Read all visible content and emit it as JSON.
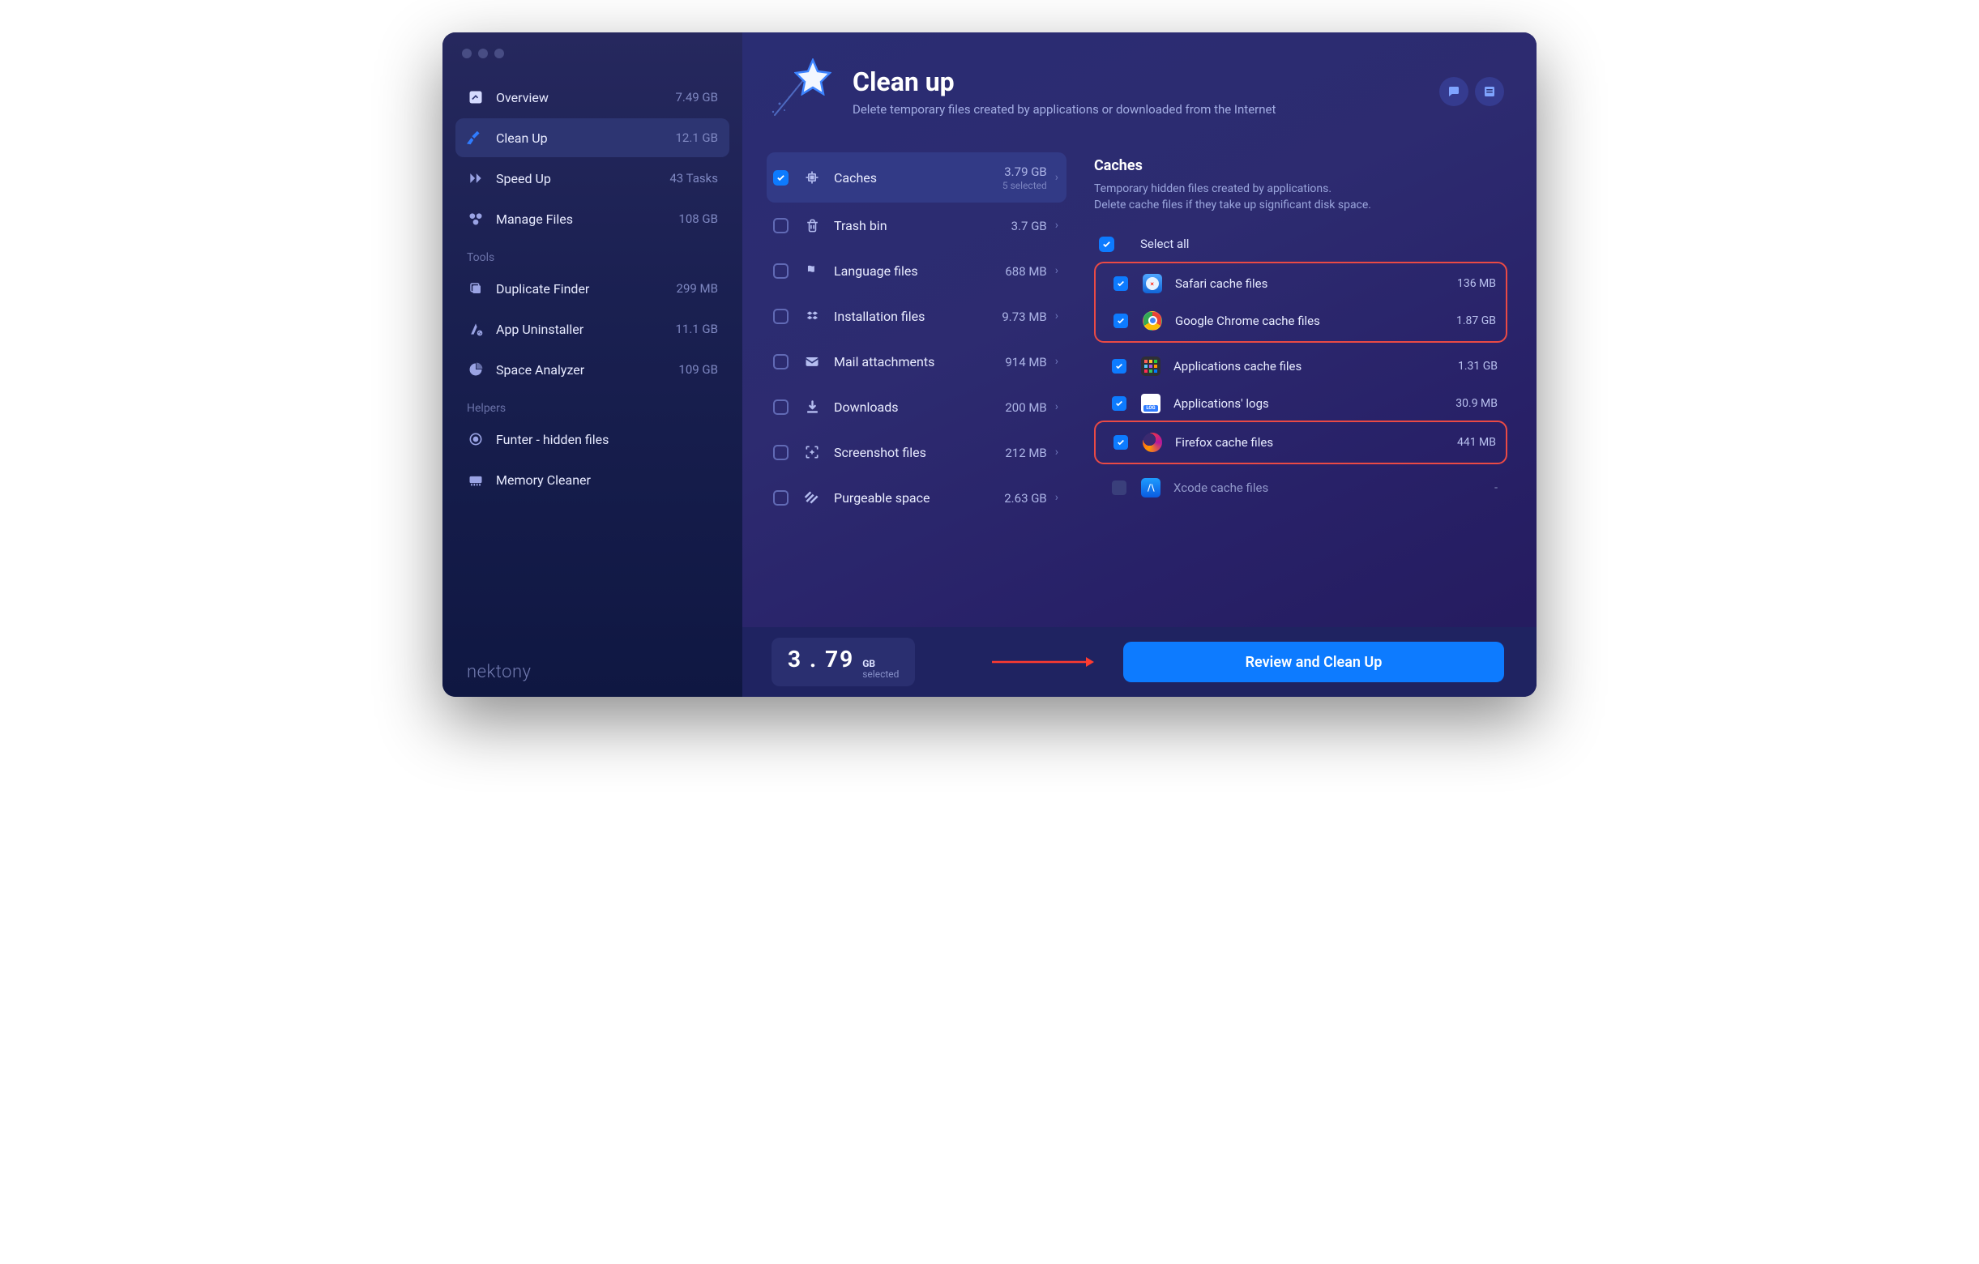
{
  "sidebar": {
    "items": [
      {
        "label": "Overview",
        "size": "7.49 GB",
        "icon": "gauge"
      },
      {
        "label": "Clean Up",
        "size": "12.1 GB",
        "icon": "broom",
        "active": true
      },
      {
        "label": "Speed Up",
        "size": "43 Tasks",
        "icon": "fastforward"
      },
      {
        "label": "Manage Files",
        "size": "108 GB",
        "icon": "hex"
      }
    ],
    "tools_label": "Tools",
    "tools": [
      {
        "label": "Duplicate Finder",
        "size": "299 MB",
        "icon": "copy"
      },
      {
        "label": "App Uninstaller",
        "size": "11.1 GB",
        "icon": "uninstall"
      },
      {
        "label": "Space Analyzer",
        "size": "109 GB",
        "icon": "pie"
      }
    ],
    "helpers_label": "Helpers",
    "helpers": [
      {
        "label": "Funter - hidden files",
        "size": "",
        "icon": "target"
      },
      {
        "label": "Memory Cleaner",
        "size": "",
        "icon": "ram"
      }
    ],
    "brand": "nektony"
  },
  "header": {
    "title": "Clean up",
    "subtitle": "Delete temporary files created by applications or downloaded from the Internet"
  },
  "categories": [
    {
      "label": "Caches",
      "size": "3.79 GB",
      "selected_hint": "5 selected",
      "checked": true,
      "active": true,
      "icon": "chip"
    },
    {
      "label": "Trash bin",
      "size": "3.7 GB",
      "icon": "trash"
    },
    {
      "label": "Language files",
      "size": "688 MB",
      "icon": "flag"
    },
    {
      "label": "Installation files",
      "size": "9.73 MB",
      "icon": "dropbox"
    },
    {
      "label": "Mail attachments",
      "size": "914 MB",
      "icon": "mail"
    },
    {
      "label": "Downloads",
      "size": "200 MB",
      "icon": "download"
    },
    {
      "label": "Screenshot files",
      "size": "212 MB",
      "icon": "screenshot"
    },
    {
      "label": "Purgeable space",
      "size": "2.63 GB",
      "icon": "stripes"
    }
  ],
  "detail": {
    "title": "Caches",
    "subtitle": "Temporary hidden files created by applications.\nDelete cache files if they take up significant disk space.",
    "select_all_label": "Select all",
    "files": [
      {
        "label": "Safari cache files",
        "size": "136 MB",
        "checked": true,
        "icon": "safari",
        "highlight": 1
      },
      {
        "label": "Google Chrome cache files",
        "size": "1.87 GB",
        "checked": true,
        "icon": "chrome",
        "highlight": 1
      },
      {
        "label": "Applications cache files",
        "size": "1.31 GB",
        "checked": true,
        "icon": "grid"
      },
      {
        "label": "Applications' logs",
        "size": "30.9 MB",
        "checked": true,
        "icon": "log"
      },
      {
        "label": "Firefox cache files",
        "size": "441 MB",
        "checked": true,
        "icon": "firefox",
        "highlight": 2
      },
      {
        "label": "Xcode cache files",
        "size": "-",
        "checked": false,
        "disabled": true,
        "icon": "xcode"
      }
    ]
  },
  "footer": {
    "total_number": "3 . 79",
    "total_unit": "GB",
    "total_sub": "selected",
    "review_button": "Review and Clean Up"
  }
}
